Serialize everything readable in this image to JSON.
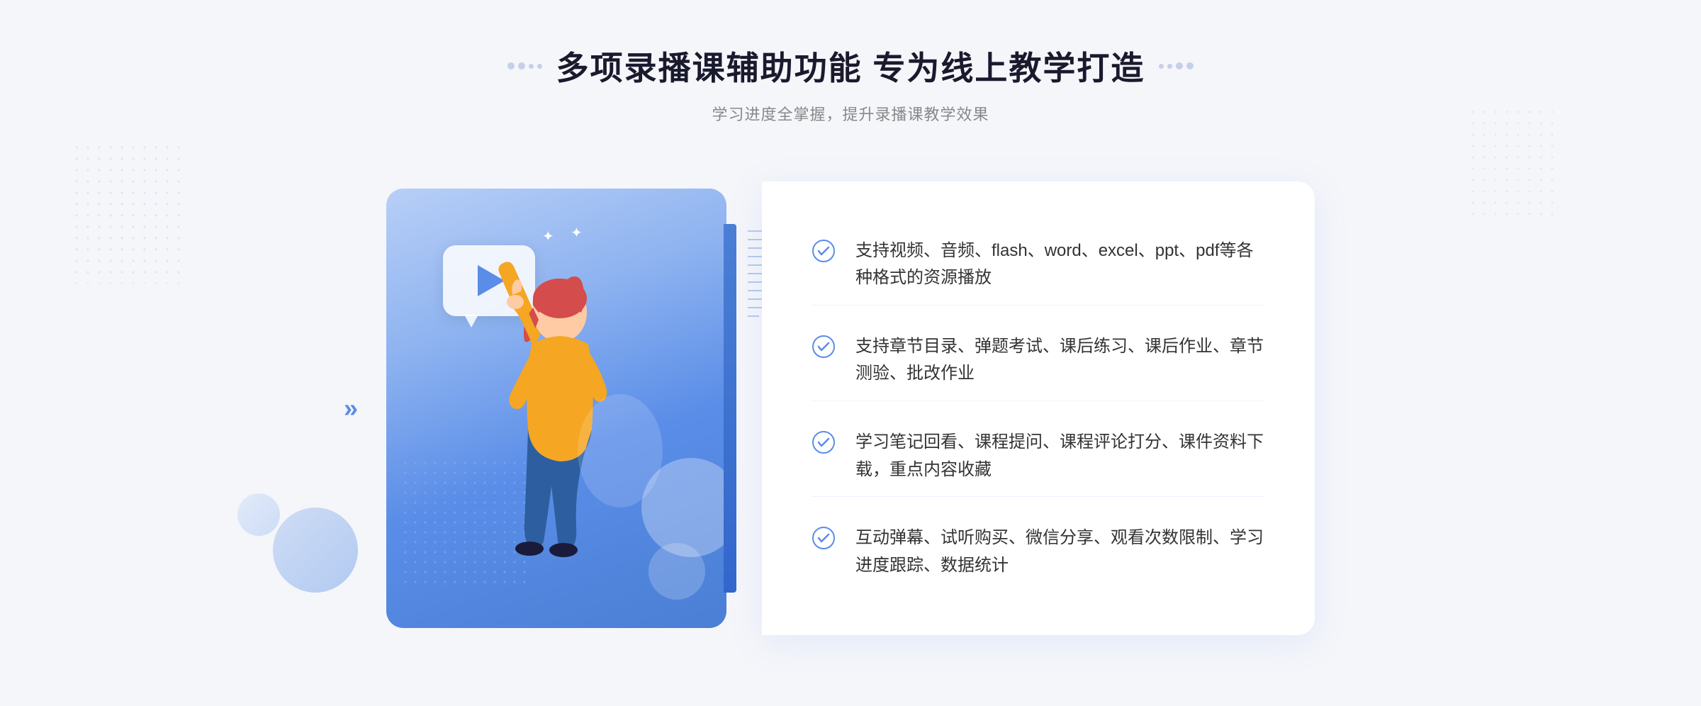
{
  "header": {
    "title": "多项录播课辅助功能 专为线上教学打造",
    "subtitle": "学习进度全掌握，提升录播课教学效果"
  },
  "features": [
    {
      "id": "feature-1",
      "text": "支持视频、音频、flash、word、excel、ppt、pdf等各种格式的资源播放"
    },
    {
      "id": "feature-2",
      "text": "支持章节目录、弹题考试、课后练习、课后作业、章节测验、批改作业"
    },
    {
      "id": "feature-3",
      "text": "学习笔记回看、课程提问、课程评论打分、课件资料下载，重点内容收藏"
    },
    {
      "id": "feature-4",
      "text": "互动弹幕、试听购买、微信分享、观看次数限制、学习进度跟踪、数据统计"
    }
  ],
  "icons": {
    "check": "check-circle-icon",
    "play": "play-icon",
    "left_arrow": "left-arrow-icon"
  },
  "colors": {
    "primary": "#4a7fd4",
    "primary_light": "#8eb3f0",
    "primary_lighter": "#b8cff7",
    "white": "#ffffff",
    "text_dark": "#1a1a2e",
    "text_gray": "#888888",
    "text_body": "#333333"
  }
}
